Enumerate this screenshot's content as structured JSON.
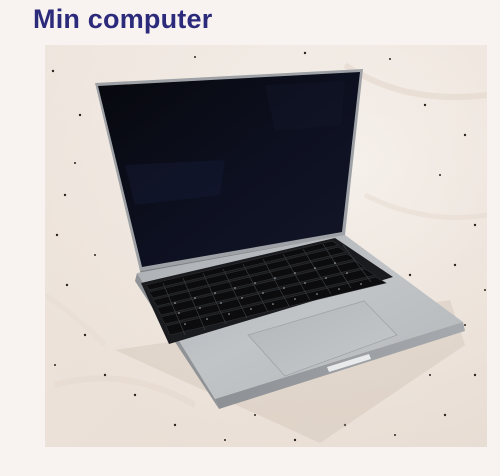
{
  "title": "Min computer",
  "photo": {
    "subject": "laptop-photo",
    "colors": {
      "sheet": "#f3ece6",
      "laptop_body": "#b9bcbf",
      "screen": "#0d0f18",
      "keys": "#141518",
      "title_text": "#2c2a7a"
    }
  }
}
